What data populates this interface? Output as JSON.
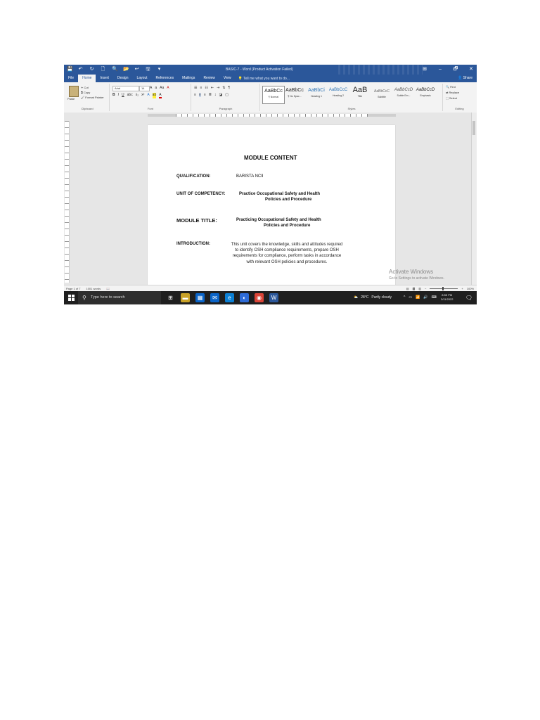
{
  "window": {
    "title": "BASIC-7 - Word (Product Activation Failed)",
    "controls": [
      "⊞",
      "–",
      "🗗",
      "✕"
    ]
  },
  "quick_access": [
    "💾",
    "↶",
    "↻",
    "🗋",
    "🔍",
    "📂",
    "↩",
    "🖫",
    "▾"
  ],
  "tabs": [
    "File",
    "Home",
    "Insert",
    "Design",
    "Layout",
    "References",
    "Mailings",
    "Review",
    "View"
  ],
  "tell_me": "Tell me what you want to do...",
  "share": "Share",
  "ribbon": {
    "clipboard": {
      "paste": "Paste",
      "cut": "Cut",
      "copy": "Copy",
      "format_painter": "Format Painter",
      "label": "Clipboard"
    },
    "font": {
      "name": "Arial",
      "size": "14",
      "label": "Font"
    },
    "paragraph": {
      "label": "Paragraph"
    },
    "styles": {
      "label": "Styles",
      "items": [
        {
          "preview": "AaBbCc",
          "name": "¶ Normal"
        },
        {
          "preview": "AaBbCc",
          "name": "¶ No Spac..."
        },
        {
          "preview": "AaBbCi",
          "name": "Heading 1"
        },
        {
          "preview": "AaBbCcC",
          "name": "Heading 2"
        },
        {
          "preview": "AaB",
          "name": "Title"
        },
        {
          "preview": "AaBbCcC",
          "name": "Subtitle"
        },
        {
          "preview": "AaBbCcD",
          "name": "Subtle Em..."
        },
        {
          "preview": "AaBbCcD",
          "name": "Emphasis"
        }
      ]
    },
    "editing": {
      "find": "Find",
      "replace": "Replace",
      "select": "Select",
      "label": "Editing"
    }
  },
  "document": {
    "title": "MODULE CONTENT",
    "qualification_label": "QUALIFICATION:",
    "qualification_value": "BARISTA NCII",
    "unit_label": "UNIT OF COMPETENCY:",
    "unit_value_1": "Practice Occupational Safety and Health",
    "unit_value_2": "Policies and Procedure",
    "module_label": "MODULE TITLE:",
    "module_value_1": "Practicing Occupational Safety and Health",
    "module_value_2": "Policies and Procedure",
    "intro_label": "INTRODUCTION:",
    "intro_text": "This unit covers the knowledge, skills and attitudes required to identify OSH compliance requirements, prepare OSH requirements for compliance, perform tasks in accordance with relevant OSH policies and procedures."
  },
  "watermark": {
    "title": "Activate Windows",
    "subtitle": "Go to Settings to activate Windows."
  },
  "status": {
    "page": "Page 1 of 7",
    "words": "1001 words",
    "zoom": "100%"
  },
  "taskbar": {
    "search_placeholder": "Type here to search",
    "weather_temp": "28°C",
    "weather_desc": "Partly cloudy",
    "time": "8:55 PM",
    "date": "3/11/2022",
    "apps": [
      {
        "glyph": "⊞",
        "color": "#1f1f1f"
      },
      {
        "glyph": "▬",
        "color": "#c9a227"
      },
      {
        "glyph": "▦",
        "color": "#0a64c8"
      },
      {
        "glyph": "✉",
        "color": "#0a64c8"
      },
      {
        "glyph": "e",
        "color": "#0b7fd4"
      },
      {
        "glyph": "◐",
        "color": "#2e6bd6"
      },
      {
        "glyph": "◉",
        "color": "#db4437"
      },
      {
        "glyph": "W",
        "color": "#2b579a"
      }
    ]
  },
  "colors": {
    "accent": "#2b579a",
    "taskbar": "#1f1f1f"
  }
}
